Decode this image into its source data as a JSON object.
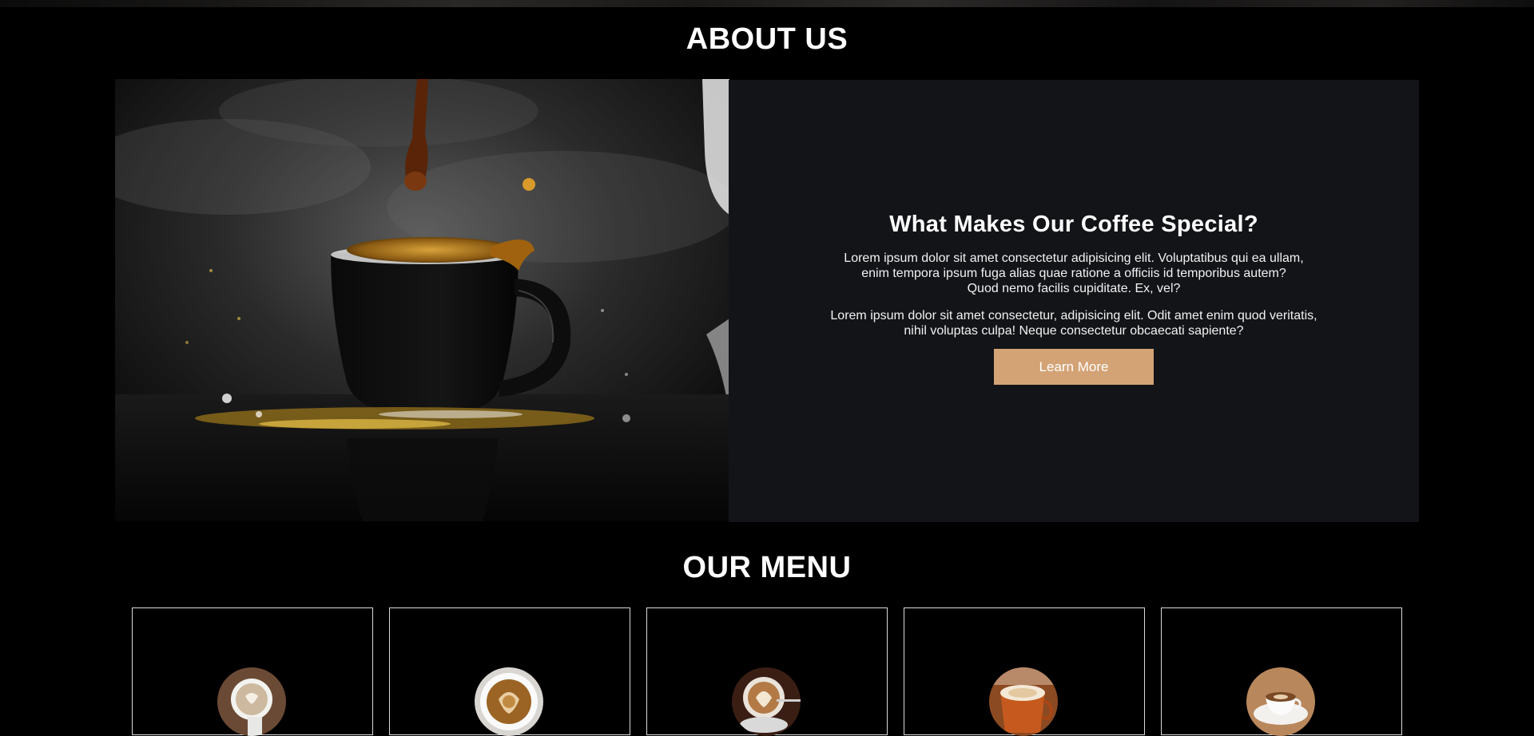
{
  "about": {
    "title": "ABOUT US",
    "image_icon": "coffee-splash-photo",
    "heading": "What Makes Our Coffee Special?",
    "paragraph1": [
      "Lorem ipsum dolor sit amet consectetur adipisicing elit. Voluptatibus qui ea ullam,",
      "enim tempora ipsum fuga alias quae ratione a officiis id temporibus autem?",
      "Quod nemo facilis cupiditate. Ex, vel?"
    ],
    "paragraph2": [
      "Lorem ipsum dolor sit amet consectetur, adipisicing elit. Odit amet enim quod veritatis,",
      "nihil voluptas culpa! Neque consectetur obcaecati sapiente?"
    ],
    "button_label": "Learn More"
  },
  "menu": {
    "title": "OUR MENU",
    "items": [
      {
        "image_icon": "latte-cup-photo"
      },
      {
        "image_icon": "cappuccino-top-photo"
      },
      {
        "image_icon": "latte-art-photo"
      },
      {
        "image_icon": "cappuccino-mug-photo"
      },
      {
        "image_icon": "coffee-saucer-photo"
      }
    ]
  },
  "colors": {
    "background": "#000000",
    "panel": "#131418",
    "accent": "#d3a375",
    "text": "#ffffff",
    "card_border": "#d9d9d9"
  }
}
